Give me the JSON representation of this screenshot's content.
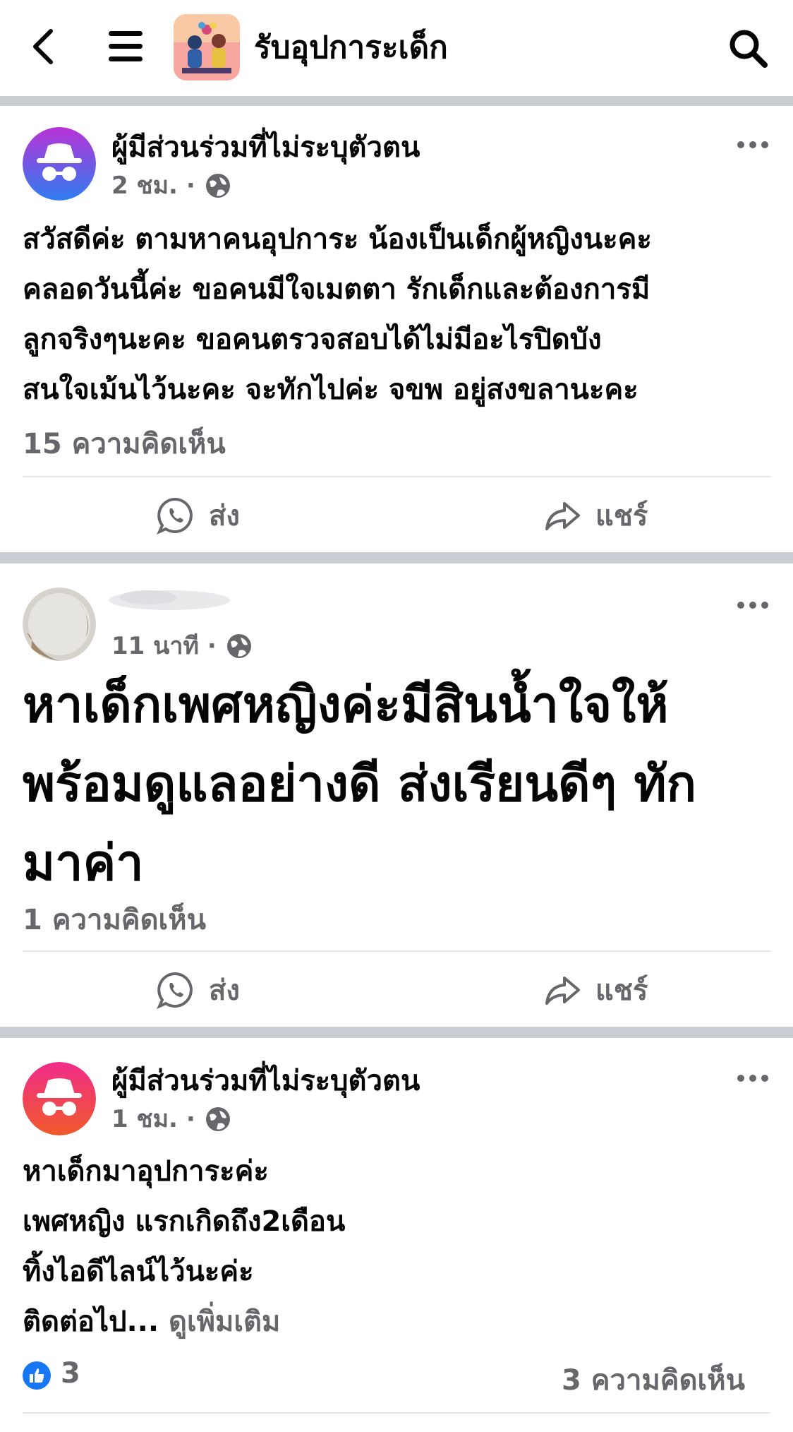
{
  "header": {
    "title": "รับอุปการะเด็ก",
    "back_icon": "chevron-left-icon",
    "menu_icon": "hamburger-menu-icon",
    "search_icon": "search-icon"
  },
  "posts": [
    {
      "author": "ผู้มีส่วนร่วมที่ไม่ระบุตัวตน",
      "time": "2 ชม.",
      "privacy_icon": "globe-icon",
      "text": "สวัสดีค่ะ ตามหาคนอุปการะ น้องเป็นเด็กผู้หญิงนะคะ\nคลอดวันนี้ค่ะ ขอคนมีใจเมตตา รักเด็กและต้องการมี\nลูกจริงๆนะคะ ขอคนตรวจสอบได้ไม่มีอะไรปิดบัง\nสนใจเม้นไว้นะคะ จะทักไปค่ะ จขพ อยู่สงขลานะคะ",
      "comments": "15 ความคิดเห็น",
      "send_label": "ส่ง",
      "share_label": "แชร์"
    },
    {
      "author": "",
      "time": "11 นาที",
      "privacy_icon": "globe-icon",
      "text": "หาเด็กเพศหญิงค่ะมีสินน้ำใจให้\nพร้อมดูแลอย่างดี ส่งเรียนดีๆ ทัก\nมาค่า",
      "comments": "1 ความคิดเห็น",
      "send_label": "ส่ง",
      "share_label": "แชร์"
    },
    {
      "author": "ผู้มีส่วนร่วมที่ไม่ระบุตัวตน",
      "time": "1 ชม.",
      "privacy_icon": "globe-icon",
      "text": "หาเด็กมาอุปการะค่ะ\nเพศหญิง แรกเกิดถึง2เดือน\nทิ้งไอดีไลน์ไว้นะค่ะ\nติดต่อไป...",
      "see_more": "ดูเพิ่มเติม",
      "likes": "3",
      "comments": "3 ความคิดเห็น"
    }
  ],
  "colors": {
    "separator": "#c9ccd1",
    "muted_text": "#65676b",
    "like_blue": "#1877f2"
  }
}
